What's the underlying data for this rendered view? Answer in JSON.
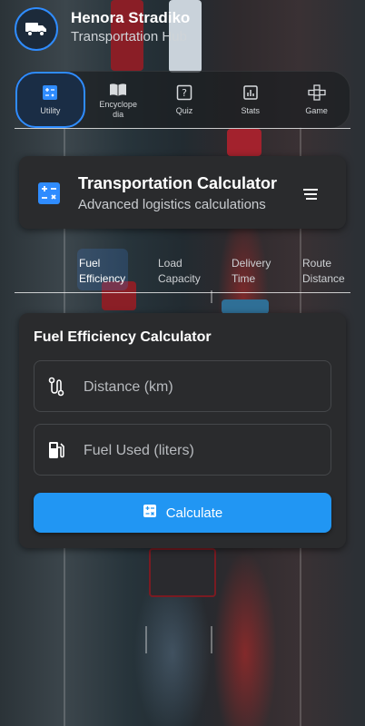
{
  "header": {
    "app_name": "Henora Stradiko",
    "subtitle": "Transportation Hub",
    "logo_icon": "truck-icon"
  },
  "nav": {
    "items": [
      {
        "label": "Utility",
        "icon": "calculator-icon",
        "active": true
      },
      {
        "label": "Encyclope\ndia",
        "icon": "book-icon",
        "active": false
      },
      {
        "label": "Quiz",
        "icon": "quiz-icon",
        "active": false
      },
      {
        "label": "Stats",
        "icon": "stats-icon",
        "active": false
      },
      {
        "label": "Game",
        "icon": "gamepad-icon",
        "active": false
      }
    ]
  },
  "title_card": {
    "title": "Transportation Calculator",
    "subtitle": "Advanced logistics calculations"
  },
  "tabs": [
    {
      "label": "Fuel\nEfficiency",
      "active": true
    },
    {
      "label": "Load\nCapacity",
      "active": false
    },
    {
      "label": "Delivery\nTime",
      "active": false
    },
    {
      "label": "Route\nDistance",
      "active": false
    }
  ],
  "calculator": {
    "title": "Fuel Efficiency Calculator",
    "distance_placeholder": "Distance (km)",
    "fuel_placeholder": "Fuel Used (liters)",
    "button_label": "Calculate"
  },
  "colors": {
    "accent": "#2196f3",
    "card_bg": "#2a2b2d"
  }
}
